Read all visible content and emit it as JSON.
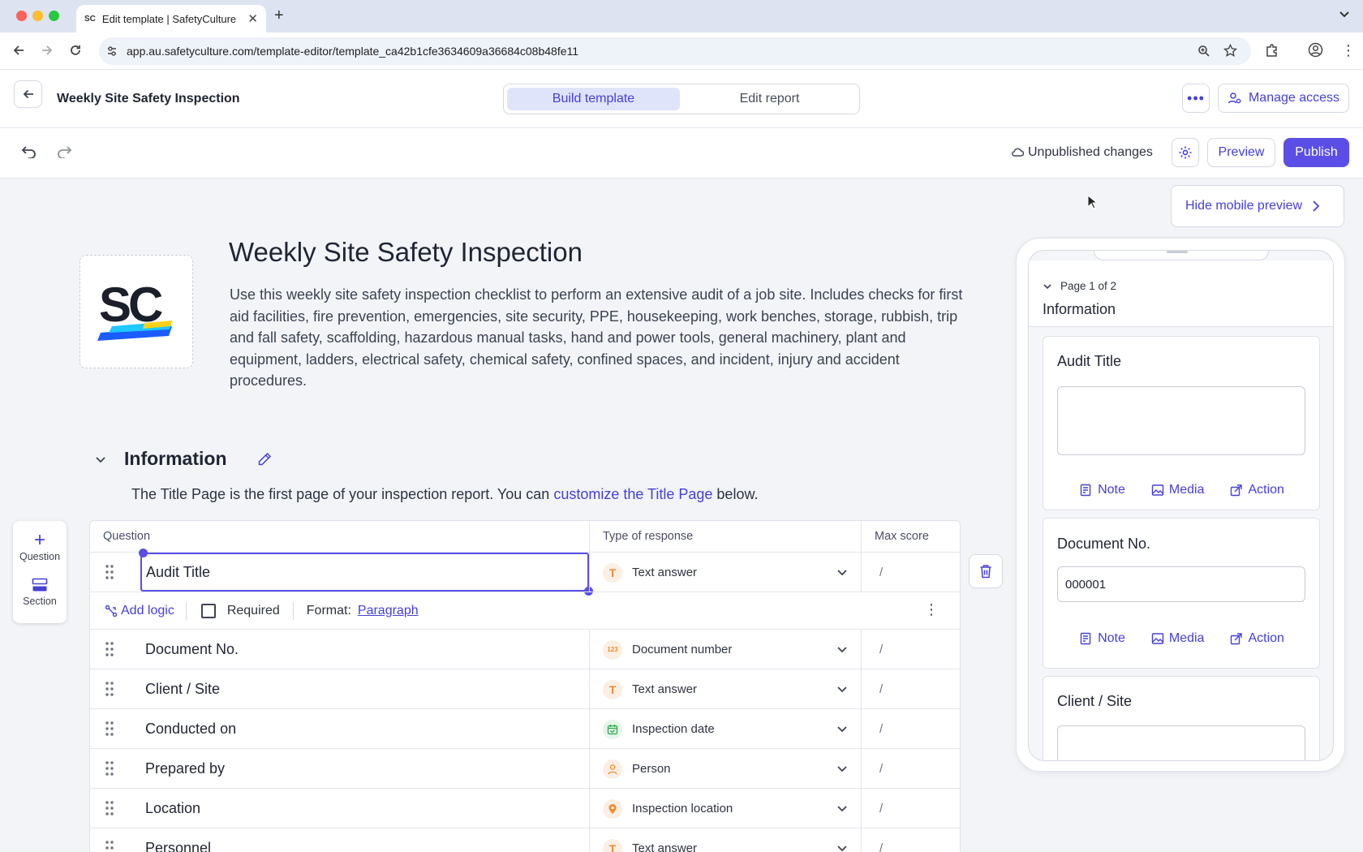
{
  "browser": {
    "tab_title": "Edit template | SafetyCulture",
    "url": "app.au.safetyculture.com/template-editor/template_ca42b1cfe3634609a36684c08b48fe11"
  },
  "header": {
    "template_name": "Weekly Site Safety Inspection",
    "tabs": [
      "Build template",
      "Edit report"
    ],
    "manage_access": "Manage access"
  },
  "toolbar": {
    "status": "Unpublished changes",
    "preview": "Preview",
    "publish": "Publish"
  },
  "template": {
    "logo_text": "SC",
    "title": "Weekly Site Safety Inspection",
    "description": "Use this weekly site safety inspection checklist to perform an extensive audit of a job site. Includes checks for first aid facilities, fire prevention, emergencies, site security, PPE, housekeeping, work benches, storage, rubbish, trip and fall safety, scaffolding, hazardous manual tasks, hand and power tools, general machinery, plant and equipment, ladders, electrical safety, chemical safety, confined spaces, and incident, injury and accident procedures."
  },
  "section": {
    "title": "Information",
    "note_before": "The Title Page is the first page of your inspection report. You can ",
    "note_link": "customize the Title Page",
    "note_after": " below."
  },
  "palette": {
    "question": "Question",
    "section": "Section"
  },
  "table": {
    "headers": {
      "question": "Question",
      "type": "Type of response",
      "max": "Max score"
    },
    "selected": {
      "question": "Audit Title",
      "type": "Text answer",
      "max": "/"
    },
    "options": {
      "add_logic": "Add logic",
      "required": "Required",
      "format_label": "Format:",
      "format_value": "Paragraph"
    },
    "rows": [
      {
        "question": "Document No.",
        "type": "Document number",
        "icon": "document-number-icon",
        "max": "/"
      },
      {
        "question": "Client / Site",
        "type": "Text answer",
        "icon": "text-answer-icon",
        "max": "/"
      },
      {
        "question": "Conducted on",
        "type": "Inspection date",
        "icon": "calendar-icon",
        "max": "/"
      },
      {
        "question": "Prepared by",
        "type": "Person",
        "icon": "person-icon",
        "max": "/"
      },
      {
        "question": "Location",
        "type": "Inspection location",
        "icon": "location-pin-icon",
        "max": "/"
      },
      {
        "question": "Personnel",
        "type": "Text answer",
        "icon": "text-answer-icon",
        "max": "/"
      }
    ]
  },
  "mobile": {
    "hide_button": "Hide mobile preview",
    "page_label": "Page 1 of 2",
    "section": "Information",
    "cards": [
      {
        "label": "Audit Title",
        "value": ""
      },
      {
        "label": "Document No.",
        "value": "000001"
      },
      {
        "label": "Client / Site",
        "value": ""
      }
    ],
    "actions": {
      "note": "Note",
      "media": "Media",
      "action": "Action"
    }
  }
}
